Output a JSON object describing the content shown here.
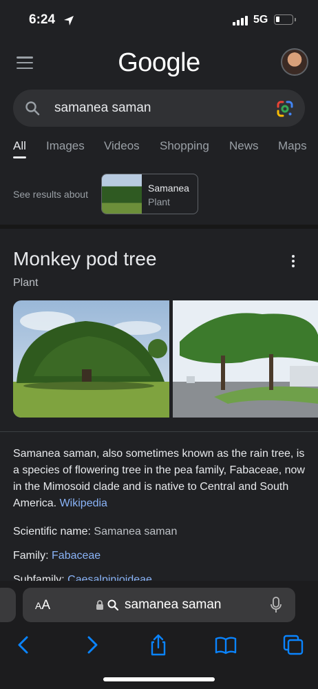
{
  "status_bar": {
    "time": "6:24",
    "network": "5G"
  },
  "header": {
    "logo": "Google"
  },
  "search": {
    "query": "samanea saman"
  },
  "tabs": [
    {
      "label": "All"
    },
    {
      "label": "Images"
    },
    {
      "label": "Videos"
    },
    {
      "label": "Shopping"
    },
    {
      "label": "News"
    },
    {
      "label": "Maps"
    }
  ],
  "see_results": {
    "label": "See results about",
    "chip_title": "Samanea",
    "chip_subtitle": "Plant"
  },
  "knowledge_panel": {
    "title": "Monkey pod tree",
    "subtitle": "Plant",
    "description": "Samanea saman, also sometimes known as the rain tree, is a species of flowering tree in the pea family, Fabaceae, now in the Mimosoid clade and is native to Central and South America.",
    "source_link": "Wikipedia",
    "facts": {
      "scientific_label": "Scientific name:",
      "scientific_value": "Samanea saman",
      "family_label": "Family:",
      "family_value": "Fabaceae",
      "subfamily_label": "Subfamily:",
      "subfamily_value": "Caesalpinioideae"
    }
  },
  "safari": {
    "aa_small": "A",
    "aa_big": "A",
    "address_text": "samanea saman"
  },
  "colors": {
    "background": "#202124",
    "link": "#8ab4f8",
    "ios_blue": "#0a84ff"
  }
}
